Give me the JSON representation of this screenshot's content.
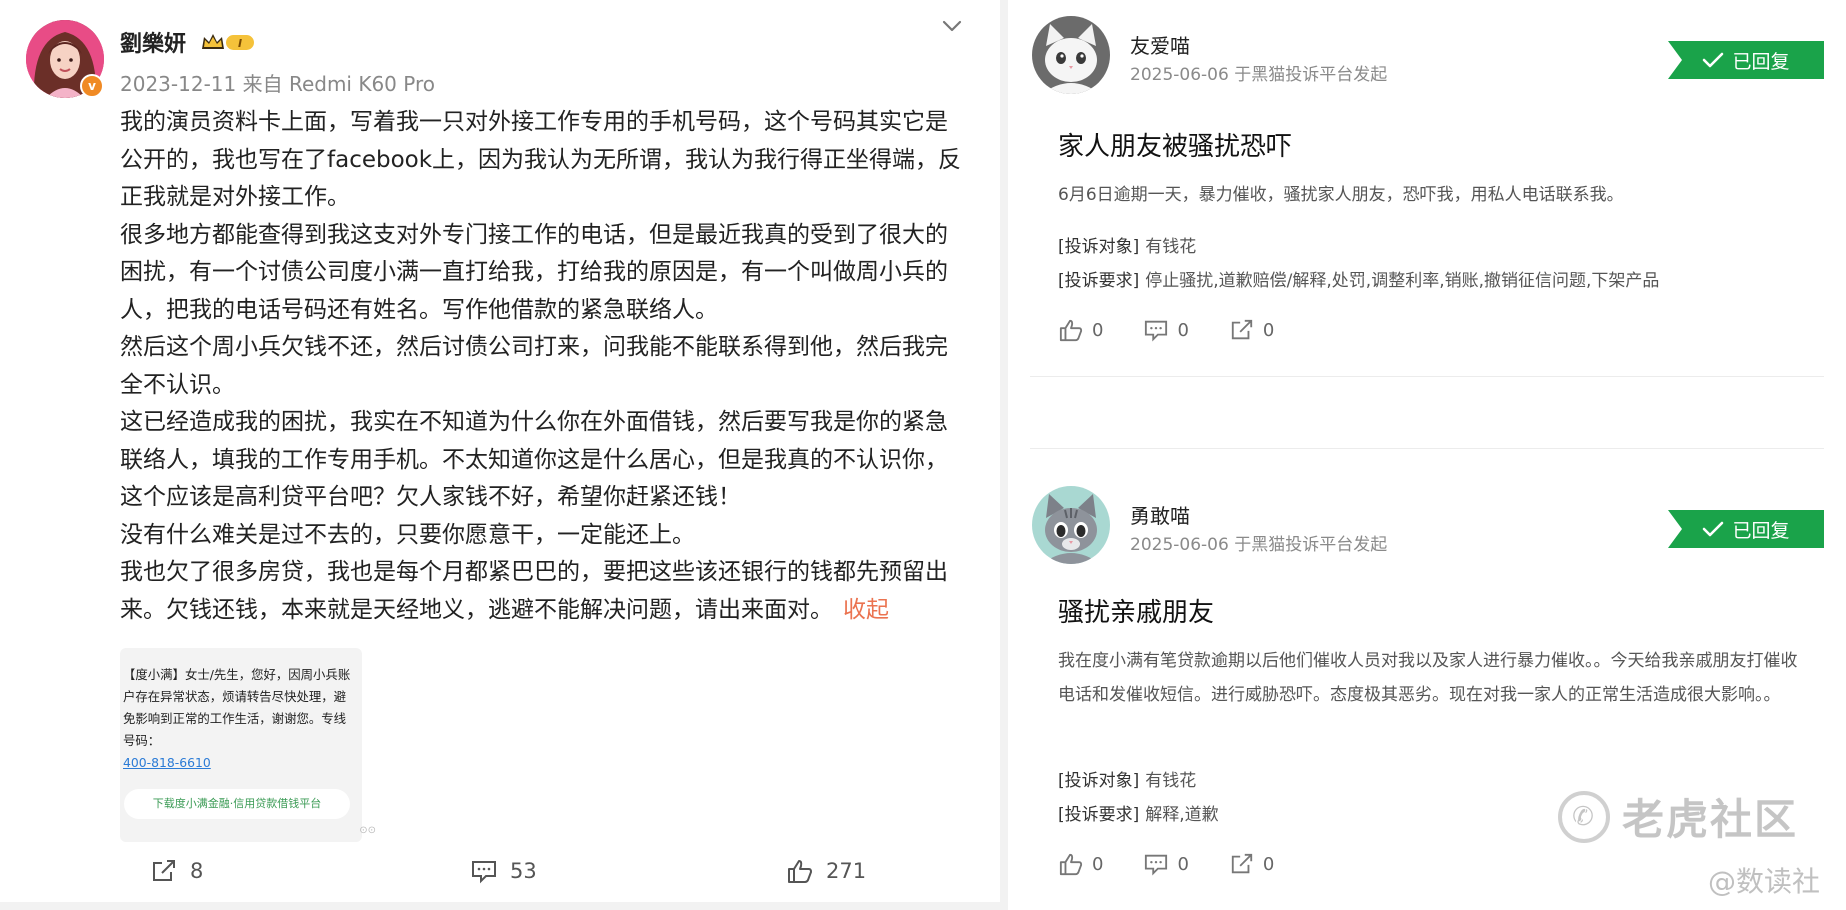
{
  "post": {
    "author": "劉樂妍",
    "level": "I",
    "date": "2023-12-11",
    "source": "来自 Redmi K60 Pro",
    "paragraphs": [
      "我的演员资料卡上面，写着我一只对外接工作专用的手机号码，这个号码其实它是公开的，我也写在了facebook上，因为我认为无所谓，我认为我行得正坐得端，反正我就是对外接工作。",
      "很多地方都能查得到我这支对外专门接工作的电话，但是最近我真的受到了很大的困扰，有一个讨债公司度小满一直打给我，打给我的原因是，有一个叫做周小兵的人，把我的电话号码还有姓名。写作他借款的紧急联络人。",
      "然后这个周小兵欠钱不还，然后讨债公司打来，问我能不能联系得到他，然后我完全不认识。",
      "这已经造成我的困扰，我实在不知道为什么你在外面借钱，然后要写我是你的紧急联络人，填我的工作专用手机。不太知道你这是什么居心，但是我真的不认识你，这个应该是高利贷平台吧？欠人家钱不好，希望你赶紧还钱！",
      "没有什么难关是过不去的，只要你愿意干，一定能还上。",
      "我也欠了很多房贷，我也是每个月都紧巴巴的，要把这些该还银行的钱都先预留出来。欠钱还钱，本来就是天经地义，逃避不能解决问题，请出来面对。"
    ],
    "collapse_label": "收起",
    "sms": {
      "text": "【度小满】女士/先生，您好，因周小兵账户存在异常状态，烦请转告尽快处理，避免影响到正常的工作生活，谢谢您。专线号码：",
      "phone": "400-818-6610",
      "banner": "下载度小满金融·信用贷款借钱平台"
    },
    "actions": {
      "share": "8",
      "comment": "53",
      "like": "271"
    }
  },
  "complaints": [
    {
      "user": "友爱喵",
      "date_line": "2025-06-06 于黑猫投诉平台发起",
      "status": "已回复",
      "title": "家人朋友被骚扰恐吓",
      "description": "6月6日逾期一天，暴力催收，骚扰家人朋友，恐吓我，用私人电话联系我。",
      "target_label": "[投诉对象]",
      "target": "有钱花",
      "request_label": "[投诉要求]",
      "request": "停止骚扰,道歉赔偿/解释,处罚,调整利率,销账,撤销征信问题,下架产品",
      "likes": "0",
      "comments": "0",
      "shares": "0"
    },
    {
      "user": "勇敢喵",
      "date_line": "2025-06-06 于黑猫投诉平台发起",
      "status": "已回复",
      "title": "骚扰亲戚朋友",
      "description": "我在度小满有笔贷款逾期以后他们催收人员对我以及家人进行暴力催收。。今天给我亲戚朋友打催收电话和发催收短信。进行威胁恐吓。态度极其恶劣。现在对我一家人的正常生活造成很大影响。。",
      "target_label": "[投诉对象]",
      "target": "有钱花",
      "request_label": "[投诉要求]",
      "request": "解释,道歉",
      "likes": "0",
      "comments": "0",
      "shares": "0"
    }
  ],
  "watermark": {
    "main": "老虎社区",
    "sub": "@数读社"
  },
  "colors": {
    "reply_green": "#1aa34a",
    "collapse_orange": "#eb7350",
    "vip_orange": "#f08a24"
  }
}
